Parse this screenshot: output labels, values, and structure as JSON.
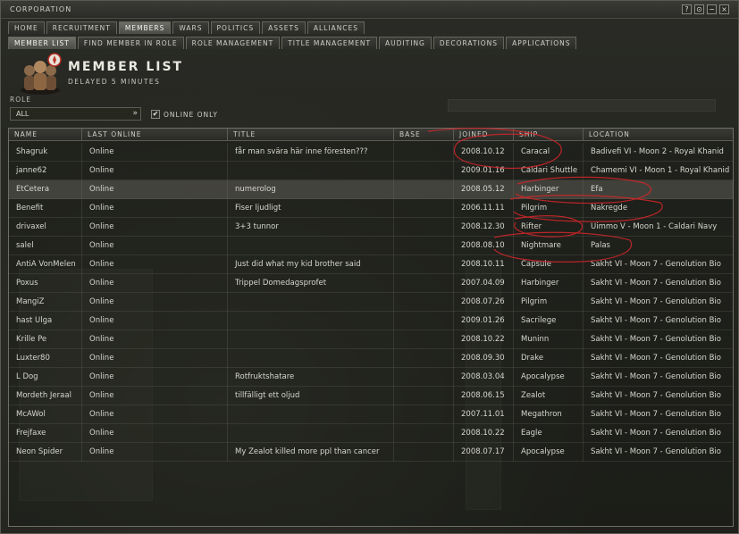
{
  "window": {
    "title": "CORPORATION",
    "buttons": [
      "?",
      "⊙",
      "−",
      "×"
    ]
  },
  "tabs": [
    {
      "label": "HOME",
      "active": false
    },
    {
      "label": "RECRUITMENT",
      "active": false
    },
    {
      "label": "MEMBERS",
      "active": true
    },
    {
      "label": "WARS",
      "active": false
    },
    {
      "label": "POLITICS",
      "active": false
    },
    {
      "label": "ASSETS",
      "active": false
    },
    {
      "label": "ALLIANCES",
      "active": false
    }
  ],
  "subtabs": [
    {
      "label": "MEMBER LIST",
      "active": true
    },
    {
      "label": "FIND MEMBER IN ROLE",
      "active": false
    },
    {
      "label": "ROLE MANAGEMENT",
      "active": false
    },
    {
      "label": "TITLE MANAGEMENT",
      "active": false
    },
    {
      "label": "AUDITING",
      "active": false
    },
    {
      "label": "DECORATIONS",
      "active": false
    },
    {
      "label": "APPLICATIONS",
      "active": false
    }
  ],
  "header": {
    "title": "MEMBER LIST",
    "subtitle": "DELAYED 5 MINUTES",
    "icon": "corporation-members-icon"
  },
  "filters": {
    "role_label": "ROLE",
    "role_value": "ALL",
    "online_only_label": "ONLINE ONLY",
    "online_only_checked": true,
    "check_mark": "✔",
    "arrow": "»"
  },
  "table": {
    "columns": [
      "NAME",
      "LAST ONLINE",
      "TITLE",
      "BASE",
      "JOINED",
      "SHIP",
      "LOCATION"
    ],
    "rows": [
      {
        "name": "Shagruk",
        "last_online": "Online",
        "title": "får man svära här inne föresten???",
        "base": "",
        "joined": "2008.10.12",
        "ship": "Caracal",
        "location": "Badivefi VI - Moon 2 - Royal Khanid"
      },
      {
        "name": "janne62",
        "last_online": "Online",
        "title": "",
        "base": "",
        "joined": "2009.01.16",
        "ship": "Caldari Shuttle",
        "location": "Chamemi VI - Moon 1 - Royal Khanid"
      },
      {
        "name": "EtCetera",
        "last_online": "Online",
        "title": "numerolog",
        "base": "",
        "joined": "2008.05.12",
        "ship": "Harbinger",
        "location": "Efa"
      },
      {
        "name": "Benefit",
        "last_online": "Online",
        "title": "Fiser ljudligt",
        "base": "",
        "joined": "2006.11.11",
        "ship": "Pilgrim",
        "location": "Nakregde"
      },
      {
        "name": "drivaxel",
        "last_online": "Online",
        "title": "3+3 tunnor",
        "base": "",
        "joined": "2008.12.30",
        "ship": "Rifter",
        "location": "Uimmo V - Moon 1 - Caldari Navy"
      },
      {
        "name": "salel",
        "last_online": "Online",
        "title": "",
        "base": "",
        "joined": "2008.08.10",
        "ship": "Nightmare",
        "location": "Palas"
      },
      {
        "name": "AntiA VonMelen",
        "last_online": "Online",
        "title": "Just did what my kid brother said",
        "base": "",
        "joined": "2008.10.11",
        "ship": "Capsule",
        "location": "Sakht VI - Moon 7 - Genolution Bio"
      },
      {
        "name": "Poxus",
        "last_online": "Online",
        "title": "Trippel Domedagsprofet",
        "base": "",
        "joined": "2007.04.09",
        "ship": "Harbinger",
        "location": "Sakht VI - Moon 7 - Genolution Bio"
      },
      {
        "name": "MangiZ",
        "last_online": "Online",
        "title": "",
        "base": "",
        "joined": "2008.07.26",
        "ship": "Pilgrim",
        "location": "Sakht VI - Moon 7 - Genolution Bio"
      },
      {
        "name": "hast Ulga",
        "last_online": "Online",
        "title": "",
        "base": "",
        "joined": "2009.01.26",
        "ship": "Sacrilege",
        "location": "Sakht VI - Moon 7 - Genolution Bio"
      },
      {
        "name": "Krille Pe",
        "last_online": "Online",
        "title": "",
        "base": "",
        "joined": "2008.10.22",
        "ship": "Muninn",
        "location": "Sakht VI - Moon 7 - Genolution Bio"
      },
      {
        "name": "Luxter80",
        "last_online": "Online",
        "title": "",
        "base": "",
        "joined": "2008.09.30",
        "ship": "Drake",
        "location": "Sakht VI - Moon 7 - Genolution Bio"
      },
      {
        "name": "L Dog",
        "last_online": "Online",
        "title": "Rotfruktshatare",
        "base": "",
        "joined": "2008.03.04",
        "ship": "Apocalypse",
        "location": "Sakht VI - Moon 7 - Genolution Bio"
      },
      {
        "name": "Mordeth Jeraal",
        "last_online": "Online",
        "title": "tillfälligt ett oljud",
        "base": "",
        "joined": "2008.06.15",
        "ship": "Zealot",
        "location": "Sakht VI - Moon 7 - Genolution Bio"
      },
      {
        "name": "McAWol",
        "last_online": "Online",
        "title": "",
        "base": "",
        "joined": "2007.11.01",
        "ship": "Megathron",
        "location": "Sakht VI - Moon 7 - Genolution Bio"
      },
      {
        "name": "Frejfaxe",
        "last_online": "Online",
        "title": "",
        "base": "",
        "joined": "2008.10.22",
        "ship": "Eagle",
        "location": "Sakht VI - Moon 7 - Genolution Bio"
      },
      {
        "name": "Neon Spider",
        "last_online": "Online",
        "title": "My Zealot killed more ppl than cancer",
        "base": "",
        "joined": "2008.07.17",
        "ship": "Apocalypse",
        "location": "Sakht VI - Moon 7 - Genolution Bio"
      }
    ],
    "selected_row": 2
  },
  "colors": {
    "annotation": "#d4262a",
    "selected_row": "#6e6e66"
  }
}
